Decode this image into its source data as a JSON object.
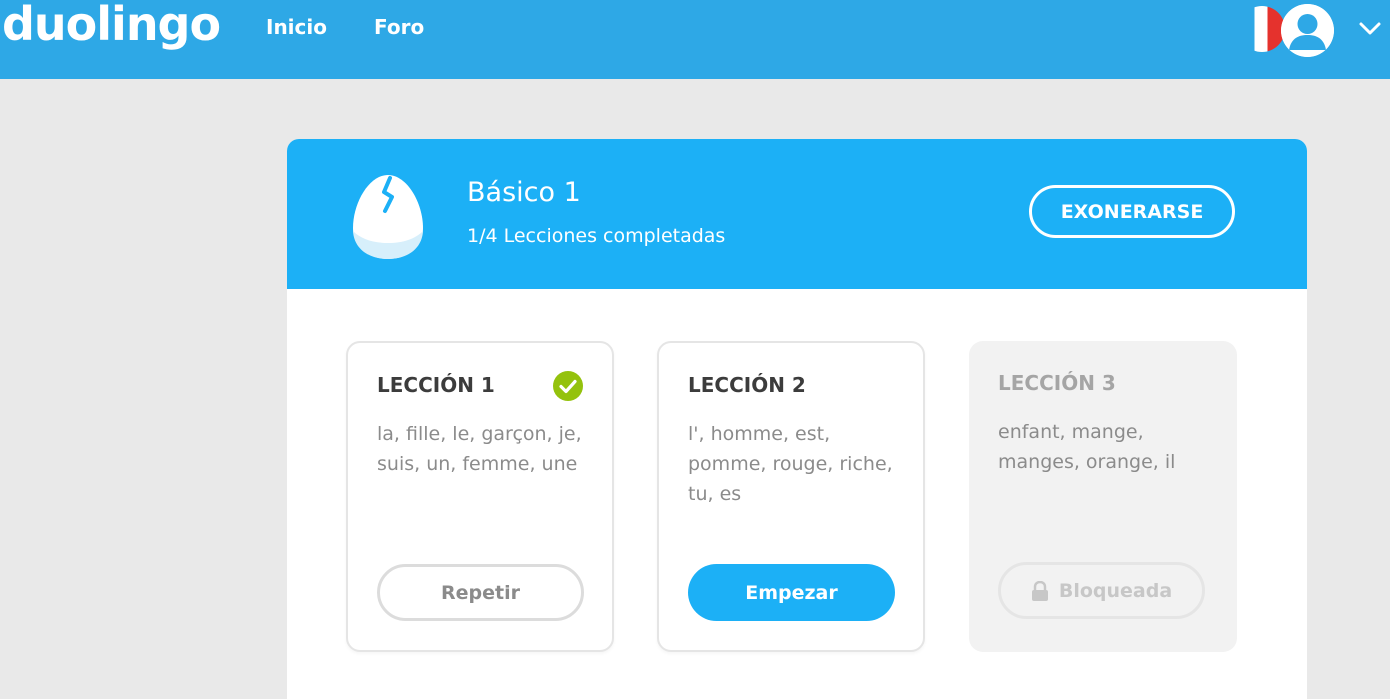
{
  "header": {
    "logo": "duolingo",
    "nav": [
      {
        "label": "Inicio"
      },
      {
        "label": "Foro"
      }
    ],
    "language_flag_icon": "france-flag-icon",
    "avatar_icon": "user-avatar-icon",
    "menu_icon": "chevron-down-icon"
  },
  "skill": {
    "icon": "cracked-egg-icon",
    "title": "Básico 1",
    "subtitle": "1/4 Lecciones completadas",
    "test_out_label": "EXONERARSE"
  },
  "lessons": [
    {
      "title": "LECCIÓN 1",
      "words": "la, fille, le, garçon, je, suis, un, femme, une",
      "status": "completed",
      "status_icon": "check-circle-icon",
      "button_label": "Repetir"
    },
    {
      "title": "LECCIÓN 2",
      "words": "l', homme, est, pomme, rouge, riche, tu, es",
      "status": "available",
      "button_label": "Empezar"
    },
    {
      "title": "LECCIÓN 3",
      "words": "enfant, mange, manges, orange, il",
      "status": "locked",
      "button_icon": "lock-icon",
      "button_label": "Bloqueada"
    }
  ],
  "colors": {
    "topbar": "#2ea8e6",
    "accent": "#1cb0f6",
    "check_green": "#94c20d",
    "background": "#e9e9e9"
  }
}
